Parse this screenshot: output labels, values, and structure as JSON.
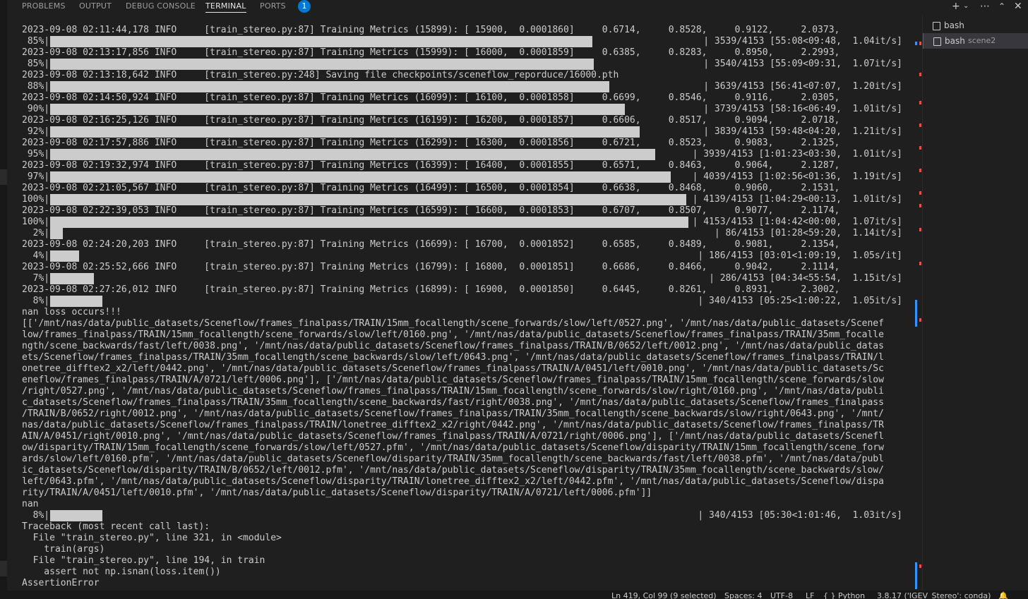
{
  "tabs": [
    {
      "label": "PROBLEMS"
    },
    {
      "label": "OUTPUT"
    },
    {
      "label": "DEBUG CONSOLE"
    },
    {
      "label": "TERMINAL"
    },
    {
      "label": "PORTS"
    }
  ],
  "ports_badge": "1",
  "toolbar": {
    "new_terminal_icon": "plus-icon",
    "dropdown_icon": "chevron-down-icon",
    "more_icon": "ellipsis-icon",
    "maximize_icon": "chevron-up-icon",
    "close_icon": "close-icon"
  },
  "terminal_lines": [
    "2023-09-08 02:11:44,178 INFO     [train_stereo.py:87] Training Metrics (15899): [ 15900,  0.0001860]     0.6714,     0.8528,     0.9122,     2.0373,",
    {
      "pct": " 85%|",
      "fill": 0.85,
      "right": "| 3539/4153 [55:08<09:48,  1.04it/s]"
    },
    "2023-09-08 02:13:17,856 INFO     [train_stereo.py:87] Training Metrics (15999): [ 16000,  0.0001859]     0.6385,     0.8283,     0.8950,     2.2993,",
    {
      "pct": " 85%|",
      "fill": 0.852,
      "right": "| 3540/4153 [55:09<09:31,  1.07it/s]"
    },
    "2023-09-08 02:13:18,642 INFO     [train_stereo.py:248] Saving file checkpoints/sceneflow_reporduce/16000.pth",
    {
      "pct": " 88%|",
      "fill": 0.876,
      "right": "| 3639/4153 [56:41<07:07,  1.20it/s]"
    },
    "2023-09-08 02:14:50,924 INFO     [train_stereo.py:87] Training Metrics (16099): [ 16100,  0.0001858]     0.6699,     0.8546,     0.9116,     2.0305,",
    {
      "pct": " 90%|",
      "fill": 0.9,
      "right": "| 3739/4153 [58:16<06:49,  1.01it/s]"
    },
    "2023-09-08 02:16:25,126 INFO     [train_stereo.py:87] Training Metrics (16199): [ 16200,  0.0001857]     0.6606,     0.8517,     0.9094,     2.0718,",
    {
      "pct": " 92%|",
      "fill": 0.924,
      "right": "| 3839/4153 [59:48<04:20,  1.21it/s]"
    },
    "2023-09-08 02:17:57,886 INFO     [train_stereo.py:87] Training Metrics (16299): [ 16300,  0.0001856]     0.6721,     0.8523,     0.9083,     2.1325,",
    {
      "pct": " 95%|",
      "fill": 0.948,
      "right": "| 3939/4153 [1:01:23<03:30,  1.01it/s]"
    },
    "2023-09-08 02:19:32,974 INFO     [train_stereo.py:87] Training Metrics (16399): [ 16400,  0.0001855]     0.6571,     0.8463,     0.9064,     2.1287,",
    {
      "pct": " 97%|",
      "fill": 0.972,
      "right": "| 4039/4153 [1:02:56<01:36,  1.19it/s]"
    },
    "2023-09-08 02:21:05,567 INFO     [train_stereo.py:87] Training Metrics (16499): [ 16500,  0.0001854]     0.6638,     0.8468,     0.9060,     2.1531,",
    {
      "pct": "100%|",
      "fill": 0.997,
      "right": "| 4139/4153 [1:04:29<00:13,  1.01it/s]"
    },
    "2023-09-08 02:22:39,053 INFO     [train_stereo.py:87] Training Metrics (16599): [ 16600,  0.0001853]     0.6707,     0.8507,     0.9077,     2.1174,",
    {
      "pct": "100%|",
      "fill": 1.0,
      "right": "| 4153/4153 [1:04:42<00:00,  1.07it/s]"
    },
    {
      "pct": "  2%|",
      "fill": 0.02,
      "right": "| 86/4153 [01:28<59:20,  1.14it/s]"
    },
    "2023-09-08 02:24:20,203 INFO     [train_stereo.py:87] Training Metrics (16699): [ 16700,  0.0001852]     0.6585,     0.8489,     0.9081,     2.1354,",
    {
      "pct": "  4%|",
      "fill": 0.045,
      "right": "| 186/4153 [03:01<1:09:19,  1.05s/it]"
    },
    "2023-09-08 02:25:52,666 INFO     [train_stereo.py:87] Training Metrics (16799): [ 16800,  0.0001851]     0.6686,     0.8466,     0.9042,     2.1114,",
    {
      "pct": "  7%|",
      "fill": 0.069,
      "right": "| 286/4153 [04:34<55:54,  1.15it/s]"
    },
    "2023-09-08 02:27:26,012 INFO     [train_stereo.py:87] Training Metrics (16899): [ 16900,  0.0001850]     0.6445,     0.8261,     0.8931,     2.3002,",
    {
      "pct": "  8%|",
      "fill": 0.082,
      "right": "| 340/4153 [05:25<1:00:22,  1.05it/s]"
    },
    "nan loss occurs!!!",
    "[['/mnt/nas/data/public_datasets/Sceneflow/frames_finalpass/TRAIN/15mm_focallength/scene_forwards/slow/left/0527.png', '/mnt/nas/data/public_datasets/Scenef",
    "low/frames_finalpass/TRAIN/15mm_focallength/scene_forwards/slow/left/0160.png', '/mnt/nas/data/public_datasets/Sceneflow/frames_finalpass/TRAIN/35mm_focalle",
    "ngth/scene_backwards/fast/left/0038.png', '/mnt/nas/data/public_datasets/Sceneflow/frames_finalpass/TRAIN/B/0652/left/0012.png', '/mnt/nas/data/public_datas",
    "ets/Sceneflow/frames_finalpass/TRAIN/35mm_focallength/scene_backwards/slow/left/0643.png', '/mnt/nas/data/public_datasets/Sceneflow/frames_finalpass/TRAIN/l",
    "onetree_difftex2_x2/left/0442.png', '/mnt/nas/data/public_datasets/Sceneflow/frames_finalpass/TRAIN/A/0451/left/0010.png', '/mnt/nas/data/public_datasets/Sc",
    "eneflow/frames_finalpass/TRAIN/A/0721/left/0006.png'], ['/mnt/nas/data/public_datasets/Sceneflow/frames_finalpass/TRAIN/15mm_focallength/scene_forwards/slow",
    "/right/0527.png', '/mnt/nas/data/public_datasets/Sceneflow/frames_finalpass/TRAIN/15mm_focallength/scene_forwards/slow/right/0160.png', '/mnt/nas/data/publi",
    "c_datasets/Sceneflow/frames_finalpass/TRAIN/35mm_focallength/scene_backwards/fast/right/0038.png', '/mnt/nas/data/public_datasets/Sceneflow/frames_finalpass",
    "/TRAIN/B/0652/right/0012.png', '/mnt/nas/data/public_datasets/Sceneflow/frames_finalpass/TRAIN/35mm_focallength/scene_backwards/slow/right/0643.png', '/mnt/",
    "nas/data/public_datasets/Sceneflow/frames_finalpass/TRAIN/lonetree_difftex2_x2/right/0442.png', '/mnt/nas/data/public_datasets/Sceneflow/frames_finalpass/TR",
    "AIN/A/0451/right/0010.png', '/mnt/nas/data/public_datasets/Sceneflow/frames_finalpass/TRAIN/A/0721/right/0006.png'], ['/mnt/nas/data/public_datasets/Scenefl",
    "ow/disparity/TRAIN/15mm_focallength/scene_forwards/slow/left/0527.pfm', '/mnt/nas/data/public_datasets/Sceneflow/disparity/TRAIN/15mm_focallength/scene_forw",
    "ards/slow/left/0160.pfm', '/mnt/nas/data/public_datasets/Sceneflow/disparity/TRAIN/35mm_focallength/scene_backwards/fast/left/0038.pfm', '/mnt/nas/data/publ",
    "ic_datasets/Sceneflow/disparity/TRAIN/B/0652/left/0012.pfm', '/mnt/nas/data/public_datasets/Sceneflow/disparity/TRAIN/35mm_focallength/scene_backwards/slow/",
    "left/0643.pfm', '/mnt/nas/data/public_datasets/Sceneflow/disparity/TRAIN/lonetree_difftex2_x2/left/0442.pfm', '/mnt/nas/data/public_datasets/Sceneflow/dispa",
    "rity/TRAIN/A/0451/left/0010.pfm', '/mnt/nas/data/public_datasets/Sceneflow/disparity/TRAIN/A/0721/left/0006.pfm']]",
    "nan",
    {
      "pct": "  8%|",
      "fill": 0.082,
      "right": "| 340/4153 [05:30<1:01:46,  1.03it/s]"
    },
    "Traceback (most recent call last):",
    "  File \"train_stereo.py\", line 321, in <module>",
    "    train(args)",
    "  File \"train_stereo.py\", line 194, in train",
    "    assert not np.isnan(loss.item())",
    "AssertionError"
  ],
  "terminals": [
    {
      "label": "bash",
      "sub": "",
      "icon": "terminal-icon"
    },
    {
      "label": "bash",
      "sub": "scene2",
      "icon": "terminal-icon"
    }
  ],
  "status": {
    "position": "Ln 419, Col 99 (9 selected)",
    "spaces": "Spaces: 4",
    "encoding": "UTF-8",
    "eol": "LF",
    "language": "{ } Python",
    "interpreter": "3.8.17 ('IGEV_Stereo': conda)"
  },
  "colors": {
    "accent": "#0078d4",
    "error_mark": "#f14c4c",
    "info_mark": "#3794ff"
  }
}
